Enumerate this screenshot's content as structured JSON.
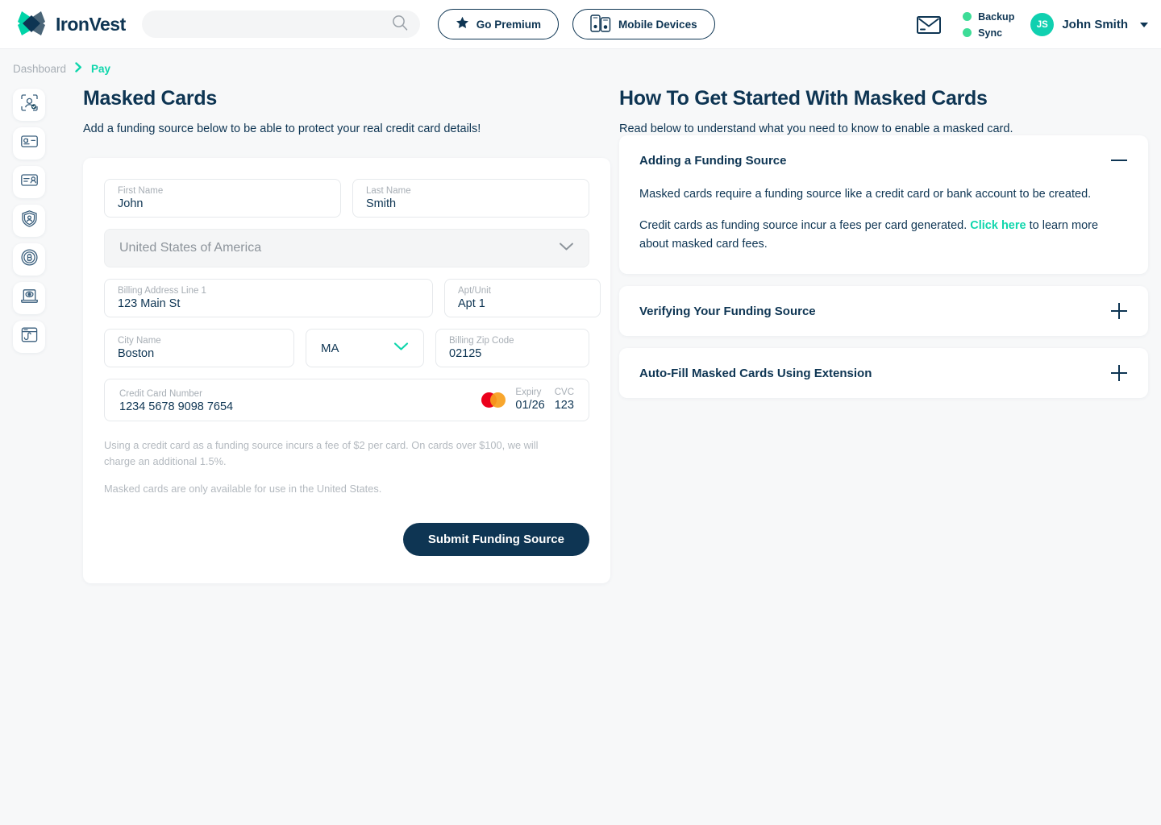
{
  "brand": {
    "name": "IronVest",
    "logo_icon": "ironvest-diamond-logo",
    "primary": "#0e3553",
    "accent": "#0fd6ac",
    "green": "#3ddc97"
  },
  "header": {
    "search": {
      "placeholder": "",
      "value": "",
      "icon": "search-icon"
    },
    "premium_button": {
      "label": "Go Premium",
      "icon": "star-icon"
    },
    "mobile_button": {
      "label": "Mobile Devices",
      "icon": "mobile-devices-icon"
    },
    "mail_icon": "mail-envelope-icon",
    "statuses": [
      {
        "label": "Backup",
        "color": "#3ddc97"
      },
      {
        "label": "Sync",
        "color": "#3ddc97"
      }
    ],
    "user": {
      "initials": "JS",
      "name": "John Smith",
      "avatar_color": "#10d0b0",
      "caret": "chevron-down-icon"
    }
  },
  "breadcrumb": {
    "parent": "Dashboard",
    "separator": "›",
    "current": "Pay"
  },
  "sidebar": {
    "items": [
      {
        "name": "identity-protection",
        "icon": "person-scan-verified-icon"
      },
      {
        "name": "masked-cards",
        "icon": "credit-card-icon"
      },
      {
        "name": "identity-card",
        "icon": "id-card-icon"
      },
      {
        "name": "account-shield",
        "icon": "shield-person-icon"
      },
      {
        "name": "crypto",
        "icon": "bitcoin-coin-icon"
      },
      {
        "name": "device-privacy",
        "icon": "laptop-eye-icon"
      },
      {
        "name": "phishing-protection",
        "icon": "browser-hook-icon"
      }
    ]
  },
  "main": {
    "title": "Masked Cards",
    "subtitle": "Add a funding source below to be able to protect your real credit card details!",
    "form": {
      "first_name": {
        "label": "First Name",
        "value": "John"
      },
      "last_name": {
        "label": "Last Name",
        "value": "Smith"
      },
      "country": {
        "value": "United States of America",
        "chevron": "chevron-down-icon"
      },
      "address1": {
        "label": "Billing Address Line 1",
        "value": "123 Main St"
      },
      "apt": {
        "label": "Apt/Unit",
        "value": "Apt 1"
      },
      "city": {
        "label": "City Name",
        "value": "Boston"
      },
      "state": {
        "value": "MA",
        "chevron": "chevron-down-icon"
      },
      "zip": {
        "label": "Billing Zip Code",
        "value": "02125"
      },
      "card": {
        "label": "Credit Card Number",
        "value": "1234 5678 9098 7654",
        "brand_icon": "mastercard-icon",
        "expiry_label": "Expiry",
        "expiry_value": "01/26",
        "cvc_label": "CVC",
        "cvc_value": "123"
      },
      "fineprint_1": "Using a credit card as a funding source incurs a fee of $2 per card. On cards over $100, we will charge an additional 1.5%.",
      "fineprint_2": "Masked cards are only available for use in the United States.",
      "submit_label": "Submit Funding Source"
    }
  },
  "help": {
    "title": "How To Get Started With Masked Cards",
    "subtitle": "Read below to understand what you need to know  to enable a masked card.",
    "items": [
      {
        "title": "Adding a Funding Source",
        "expanded": true,
        "toggle_icon": "minus-icon",
        "p1": "Masked cards require a funding source like a credit card or bank account to be created.",
        "p2_before": "Credit cards as funding source incur a fees per card generated. ",
        "p2_link": "Click here",
        "p2_after": " to learn more about masked card fees."
      },
      {
        "title": "Verifying Your Funding Source",
        "expanded": false,
        "toggle_icon": "plus-icon"
      },
      {
        "title": "Auto-Fill Masked Cards Using Extension",
        "expanded": false,
        "toggle_icon": "plus-icon"
      }
    ]
  }
}
